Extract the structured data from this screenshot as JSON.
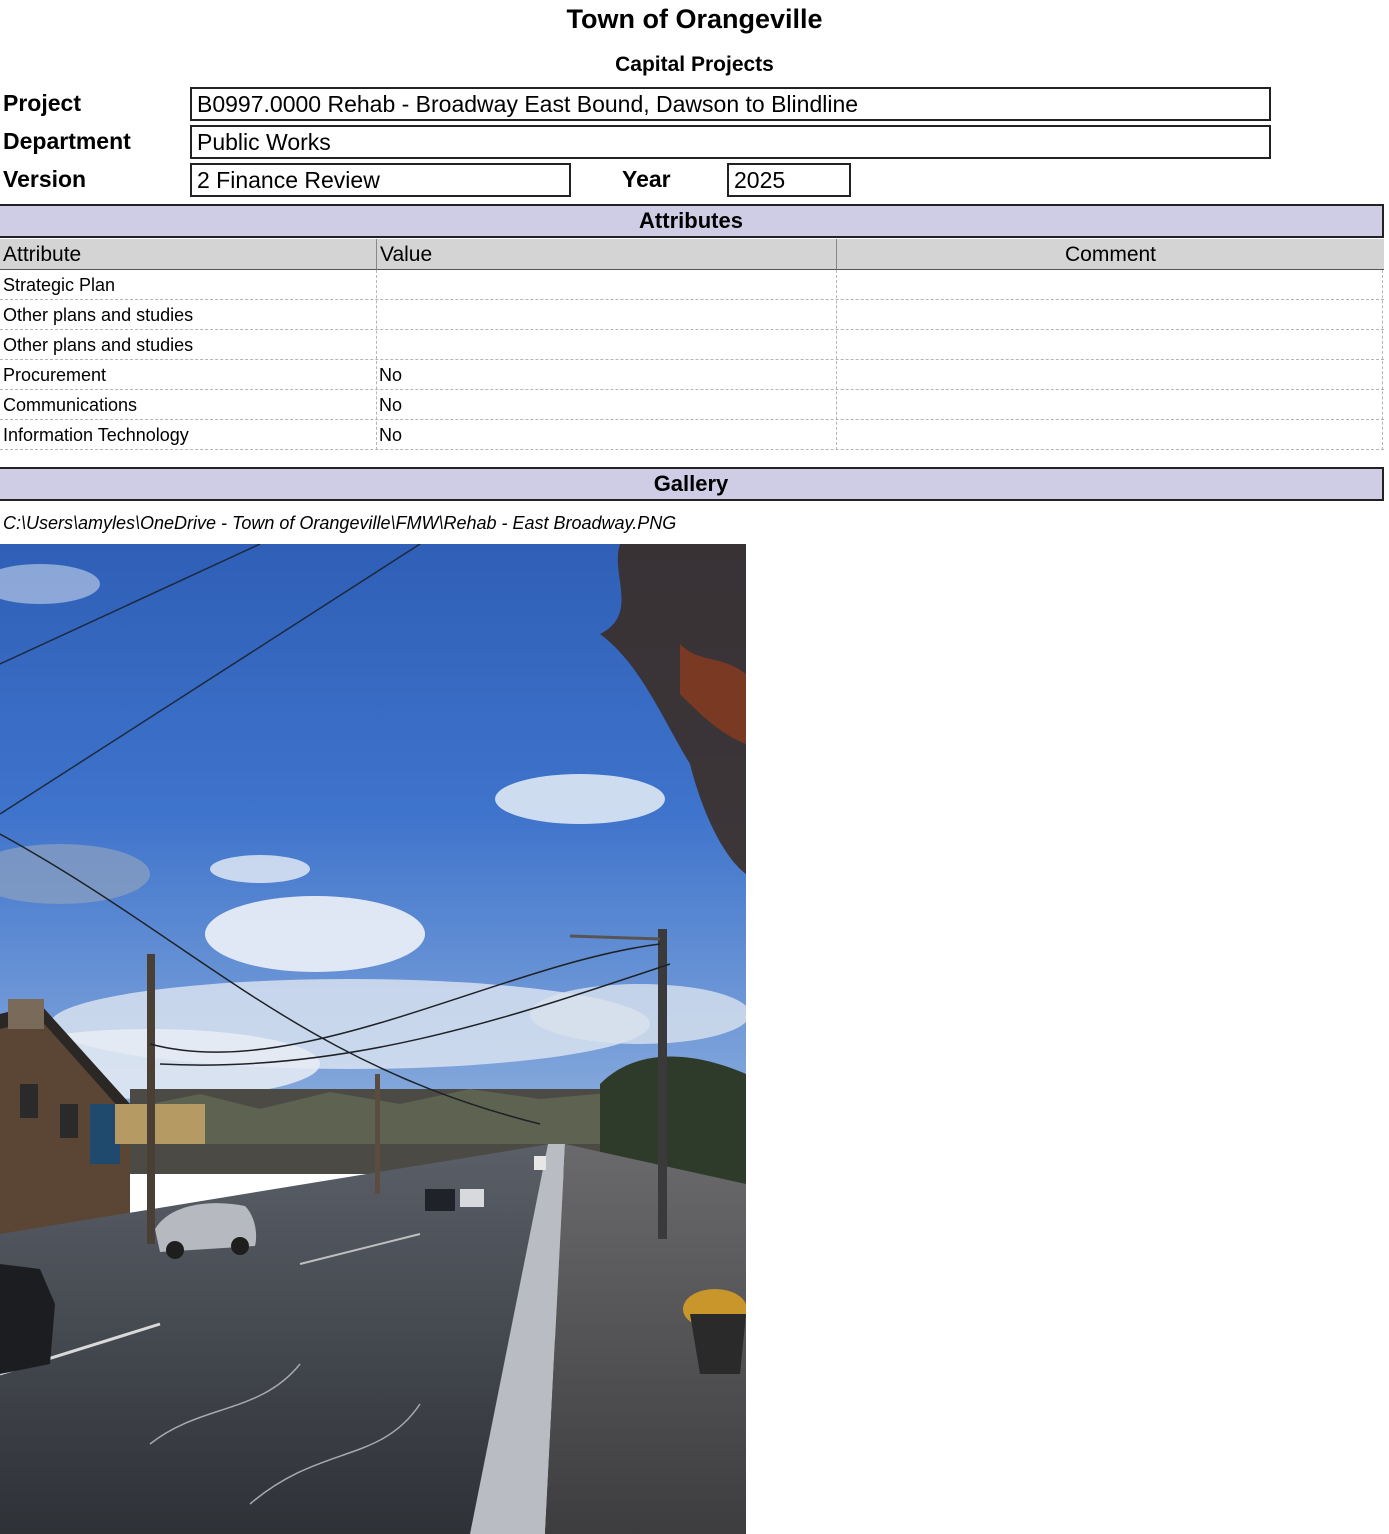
{
  "header": {
    "title": "Town of Orangeville",
    "subtitle": "Capital Projects",
    "project_label": "Project",
    "project_value": "B0997.0000 Rehab - Broadway East Bound, Dawson to Blindline",
    "department_label": "Department",
    "department_value": "Public Works",
    "version_label": "Version",
    "version_value": "2 Finance Review",
    "year_label": "Year",
    "year_value": "2025"
  },
  "attributes": {
    "section_title": "Attributes",
    "columns": [
      "Attribute",
      "Value",
      "Comment"
    ],
    "rows": [
      {
        "attribute": "Strategic Plan",
        "value": "",
        "comment": ""
      },
      {
        "attribute": "Other plans and studies",
        "value": "",
        "comment": ""
      },
      {
        "attribute": "Other plans and studies",
        "value": "",
        "comment": ""
      },
      {
        "attribute": "Procurement",
        "value": "No",
        "comment": ""
      },
      {
        "attribute": "Communications",
        "value": "No",
        "comment": ""
      },
      {
        "attribute": "Information Technology",
        "value": "No",
        "comment": ""
      }
    ]
  },
  "gallery": {
    "section_title": "Gallery",
    "file_path": "C:\\Users\\amyles\\OneDrive - Town of Orangeville\\FMW\\Rehab - East Broadway.PNG",
    "photo_icon": "street-photo"
  },
  "colors": {
    "section_bar": "#cfcce6",
    "column_header": "#d4d4d4"
  }
}
